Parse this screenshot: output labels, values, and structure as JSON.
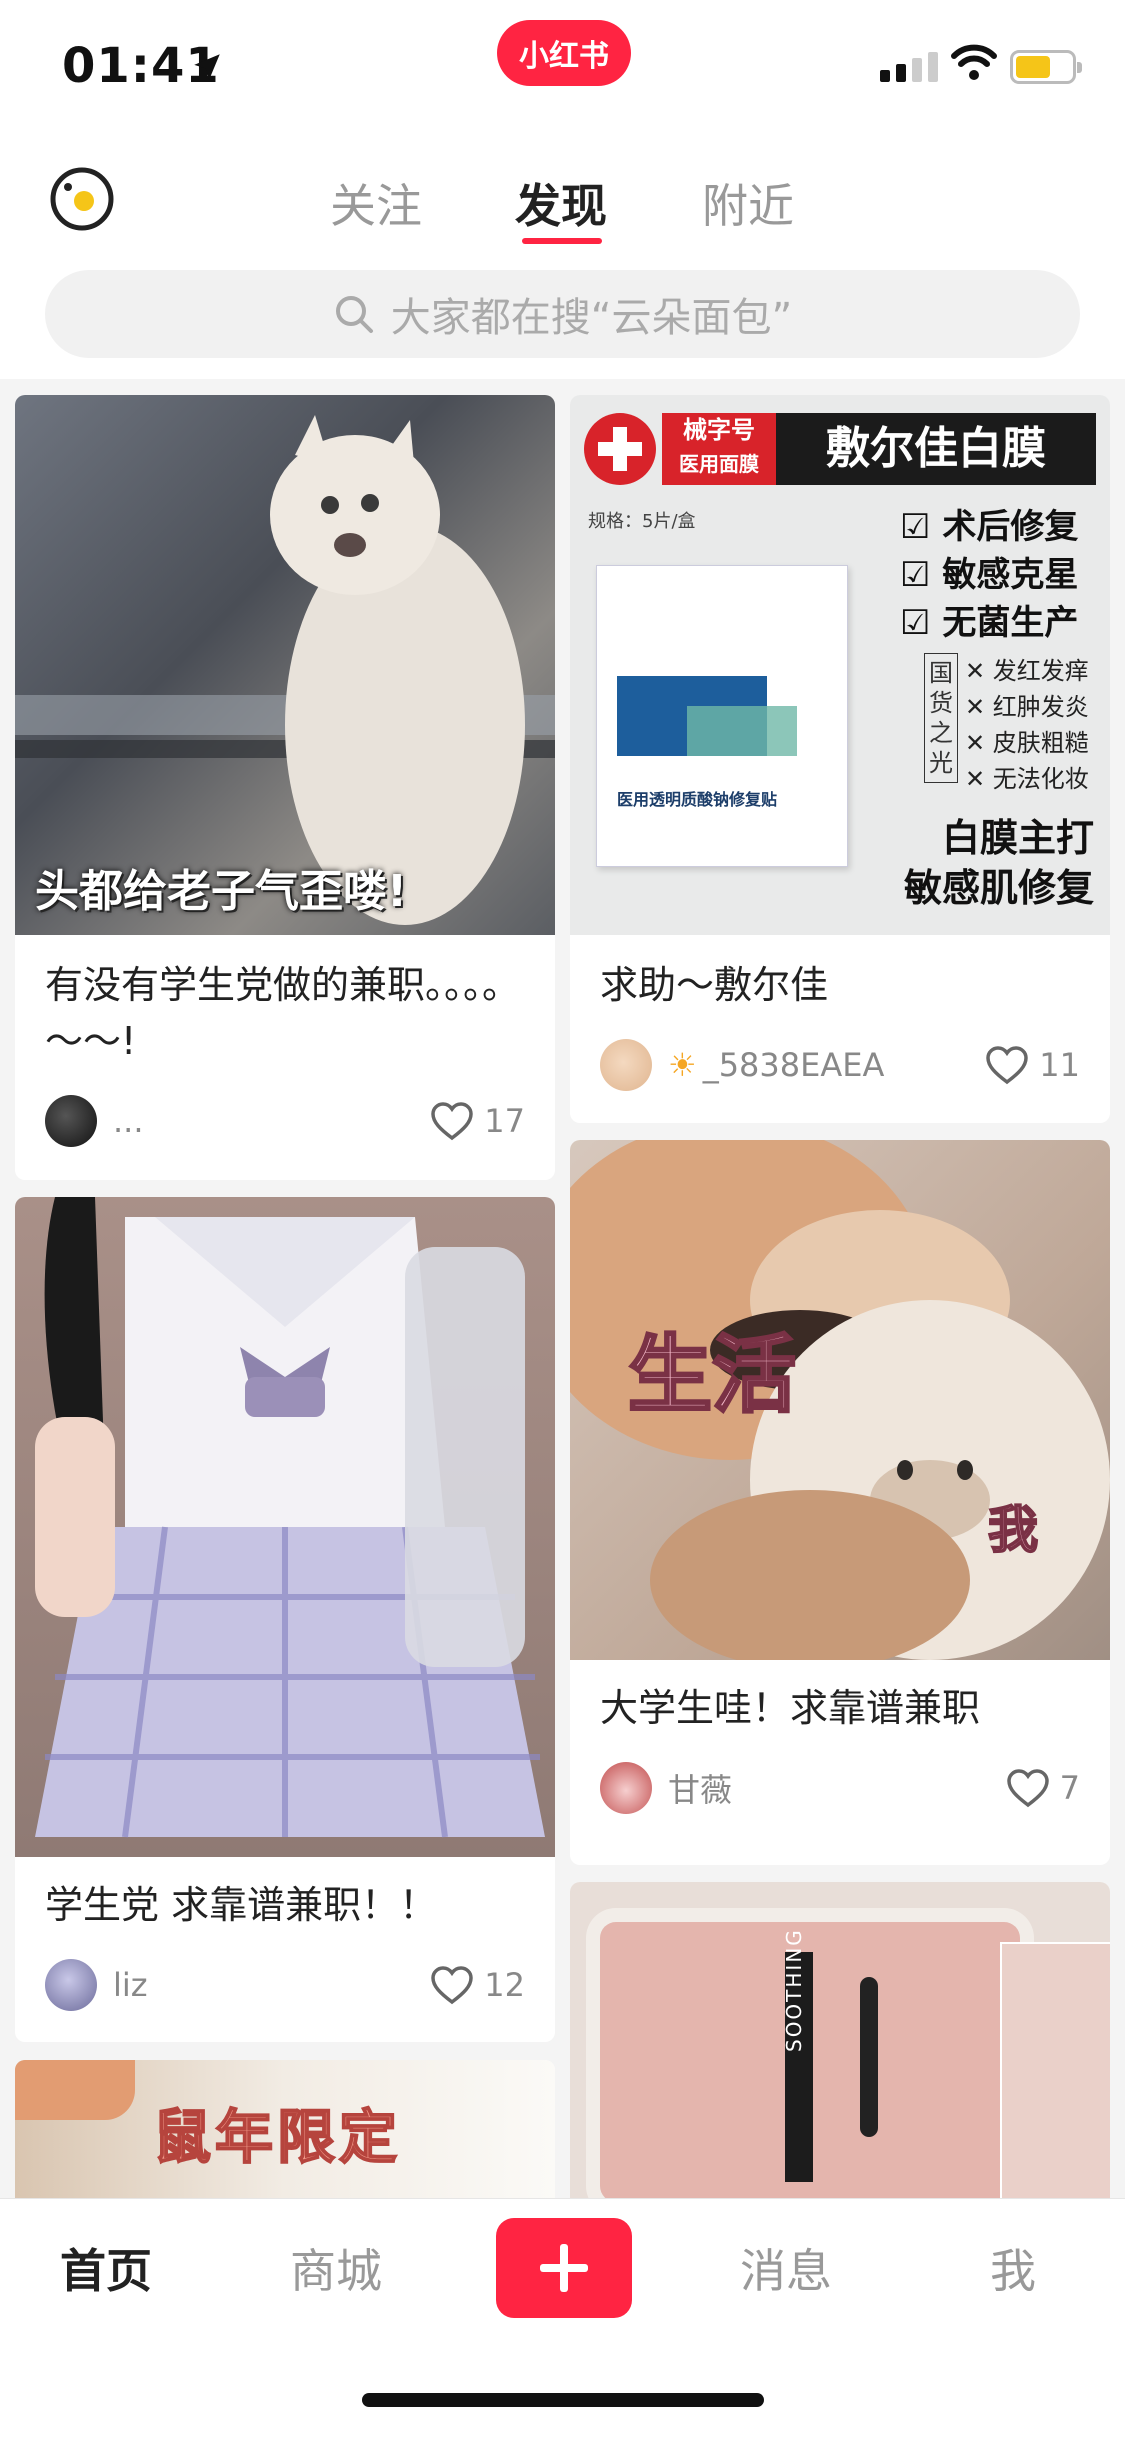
{
  "status_bar": {
    "time": "01:41",
    "brand": "小红书"
  },
  "header": {
    "tabs": [
      {
        "label": "关注"
      },
      {
        "label": "发现"
      },
      {
        "label": "附近"
      }
    ],
    "active_tab": "发现",
    "search_placeholder": "大家都在搜“云朵面包”"
  },
  "feed": {
    "cards": [
      {
        "title": "有没有学生党做的兼职。。。。～～!",
        "image_caption": "头都给老子气歪喽!",
        "author": "...",
        "likes": "17"
      },
      {
        "title": "求助～敷尔佳",
        "author": "_5838EAEA",
        "likes": "11",
        "image_text": {
          "badge_top": "械字号",
          "badge_bottom": "医用面膜",
          "brand_title": "敷尔佳白膜",
          "spec": "规格：5片/盒",
          "checks": [
            "术后修复",
            "敏感克星",
            "无菌生产"
          ],
          "vertical": "国货之光",
          "crosses": [
            "发红发痒",
            "红肿发炎",
            "皮肤粗糙",
            "无法化妆"
          ],
          "box_label": "医用透明质酸钠修复贴",
          "bottom": [
            "白膜主打",
            "敏感肌修复"
          ]
        }
      },
      {
        "title": "学生党 求靠谱兼职！！",
        "author": "liz",
        "likes": "12"
      },
      {
        "title": "大学生哇！求靠谱兼职",
        "image_text": {
          "big": "生活",
          "small": "我"
        },
        "author": "甘薇",
        "likes": "7"
      },
      {
        "image_text": {
          "banner": "鼠年限定"
        }
      },
      {
        "image_text": {
          "vertical": "SOOTHING"
        }
      }
    ]
  },
  "bottom_nav": {
    "items": [
      "首页",
      "商城",
      "消息",
      "我"
    ],
    "active": "首页"
  },
  "colors": {
    "accent": "#ff2442"
  }
}
